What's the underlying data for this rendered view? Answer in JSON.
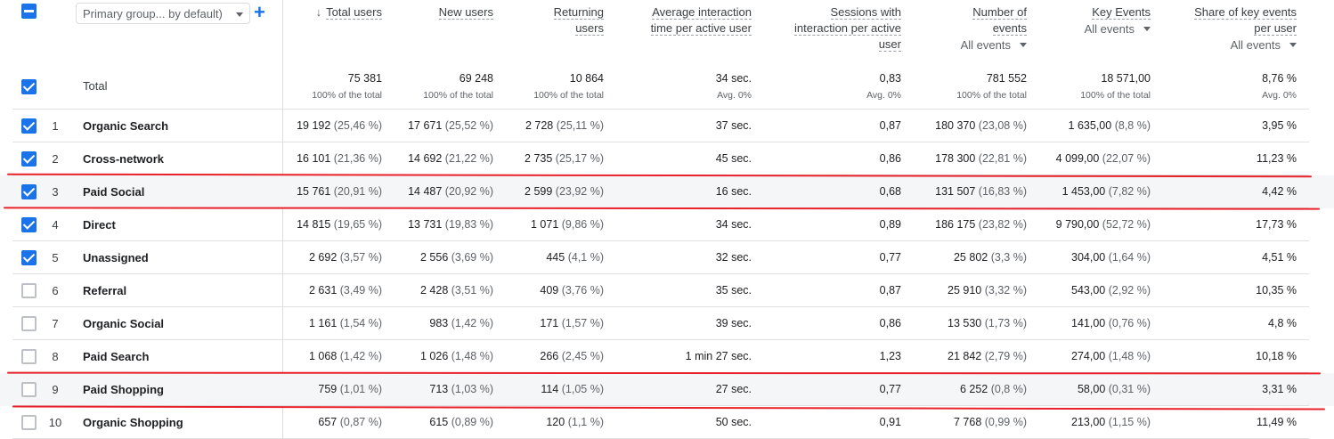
{
  "header": {
    "dimension_select": "Primary group... by default)",
    "add_icon": "plus-icon",
    "columns": [
      {
        "title": [
          "Total users"
        ],
        "sorted": true,
        "sub": ""
      },
      {
        "title": [
          "New users"
        ],
        "sub": ""
      },
      {
        "title": [
          "Returning",
          "users"
        ],
        "sub": ""
      },
      {
        "title": [
          "Average interaction",
          "time per active user"
        ],
        "sub": ""
      },
      {
        "title": [
          "Sessions with",
          "interaction per active",
          "user"
        ],
        "sub": ""
      },
      {
        "title": [
          "Number of",
          "events"
        ],
        "sub": "All events"
      },
      {
        "title": [
          "Key Events"
        ],
        "sub": "All events"
      },
      {
        "title": [
          "Share of key events",
          "per user"
        ],
        "sub": "All events"
      }
    ]
  },
  "total": {
    "label": "Total",
    "values": [
      "75 381",
      "69 248",
      "10 864",
      "34 sec.",
      "0,83",
      "781 552",
      "18 571,00",
      "8,76 %"
    ],
    "subs": [
      "100% of the total",
      "100% of the total",
      "100% of the total",
      "Avg. 0%",
      "Avg. 0%",
      "100% of the total",
      "100% of the total",
      "Avg. 0%"
    ]
  },
  "rows": [
    {
      "index": "1",
      "name": "Organic Search",
      "checked": true,
      "cells": [
        [
          "19 192",
          "(25,46 %)"
        ],
        [
          "17 671",
          "(25,52 %)"
        ],
        [
          "2 728",
          "(25,11 %)"
        ],
        [
          "37 sec.",
          ""
        ],
        [
          "0,87",
          ""
        ],
        [
          "180 370",
          "(23,08 %)"
        ],
        [
          "1 635,00",
          "(8,8 %)"
        ],
        [
          "3,95 %",
          ""
        ]
      ]
    },
    {
      "index": "2",
      "name": "Cross-network",
      "checked": true,
      "cells": [
        [
          "16 101",
          "(21,36 %)"
        ],
        [
          "14 692",
          "(21,22 %)"
        ],
        [
          "2 735",
          "(25,17 %)"
        ],
        [
          "45 sec.",
          ""
        ],
        [
          "0,86",
          ""
        ],
        [
          "178 300",
          "(22,81 %)"
        ],
        [
          "4 099,00",
          "(22,07 %)"
        ],
        [
          "11,23 %",
          ""
        ]
      ]
    },
    {
      "index": "3",
      "name": "Paid Social",
      "checked": true,
      "shaded": true,
      "cells": [
        [
          "15 761",
          "(20,91 %)"
        ],
        [
          "14 487",
          "(20,92 %)"
        ],
        [
          "2 599",
          "(23,92 %)"
        ],
        [
          "16 sec.",
          ""
        ],
        [
          "0,68",
          ""
        ],
        [
          "131 507",
          "(16,83 %)"
        ],
        [
          "1 453,00",
          "(7,82 %)"
        ],
        [
          "4,42 %",
          ""
        ]
      ]
    },
    {
      "index": "4",
      "name": "Direct",
      "checked": true,
      "cells": [
        [
          "14 815",
          "(19,65 %)"
        ],
        [
          "13 731",
          "(19,83 %)"
        ],
        [
          "1 071",
          "(9,86 %)"
        ],
        [
          "34 sec.",
          ""
        ],
        [
          "0,89",
          ""
        ],
        [
          "186 175",
          "(23,82 %)"
        ],
        [
          "9 790,00",
          "(52,72 %)"
        ],
        [
          "17,73 %",
          ""
        ]
      ]
    },
    {
      "index": "5",
      "name": "Unassigned",
      "checked": true,
      "cells": [
        [
          "2 692",
          "(3,57 %)"
        ],
        [
          "2 556",
          "(3,69 %)"
        ],
        [
          "445",
          "(4,1 %)"
        ],
        [
          "32 sec.",
          ""
        ],
        [
          "0,77",
          ""
        ],
        [
          "25 802",
          "(3,3 %)"
        ],
        [
          "304,00",
          "(1,64 %)"
        ],
        [
          "4,51 %",
          ""
        ]
      ]
    },
    {
      "index": "6",
      "name": "Referral",
      "checked": false,
      "cells": [
        [
          "2 631",
          "(3,49 %)"
        ],
        [
          "2 428",
          "(3,51 %)"
        ],
        [
          "409",
          "(3,76 %)"
        ],
        [
          "35 sec.",
          ""
        ],
        [
          "0,87",
          ""
        ],
        [
          "25 910",
          "(3,32 %)"
        ],
        [
          "543,00",
          "(2,92 %)"
        ],
        [
          "10,35 %",
          ""
        ]
      ]
    },
    {
      "index": "7",
      "name": "Organic Social",
      "checked": false,
      "cells": [
        [
          "1 161",
          "(1,54 %)"
        ],
        [
          "983",
          "(1,42 %)"
        ],
        [
          "171",
          "(1,57 %)"
        ],
        [
          "39 sec.",
          ""
        ],
        [
          "0,86",
          ""
        ],
        [
          "13 530",
          "(1,73 %)"
        ],
        [
          "141,00",
          "(0,76 %)"
        ],
        [
          "4,8 %",
          ""
        ]
      ]
    },
    {
      "index": "8",
      "name": "Paid Search",
      "checked": false,
      "cells": [
        [
          "1 068",
          "(1,42 %)"
        ],
        [
          "1 026",
          "(1,48 %)"
        ],
        [
          "266",
          "(2,45 %)"
        ],
        [
          "1 min 27 sec.",
          ""
        ],
        [
          "1,23",
          ""
        ],
        [
          "21 842",
          "(2,79 %)"
        ],
        [
          "274,00",
          "(1,48 %)"
        ],
        [
          "10,18 %",
          ""
        ]
      ]
    },
    {
      "index": "9",
      "name": "Paid Shopping",
      "checked": false,
      "shaded": true,
      "cells": [
        [
          "759",
          "(1,01 %)"
        ],
        [
          "713",
          "(1,03 %)"
        ],
        [
          "114",
          "(1,05 %)"
        ],
        [
          "27 sec.",
          ""
        ],
        [
          "0,77",
          ""
        ],
        [
          "6 252",
          "(0,8 %)"
        ],
        [
          "58,00",
          "(0,31 %)"
        ],
        [
          "3,31 %",
          ""
        ]
      ]
    },
    {
      "index": "10",
      "name": "Organic Shopping",
      "checked": false,
      "cells": [
        [
          "657",
          "(0,87 %)"
        ],
        [
          "615",
          "(0,89 %)"
        ],
        [
          "120",
          "(1,1 %)"
        ],
        [
          "50 sec.",
          ""
        ],
        [
          "0,91",
          ""
        ],
        [
          "7 768",
          "(0,99 %)"
        ],
        [
          "213,00",
          "(1,15 %)"
        ],
        [
          "11,49 %",
          ""
        ]
      ]
    }
  ],
  "annotation_color": "#e8212b"
}
